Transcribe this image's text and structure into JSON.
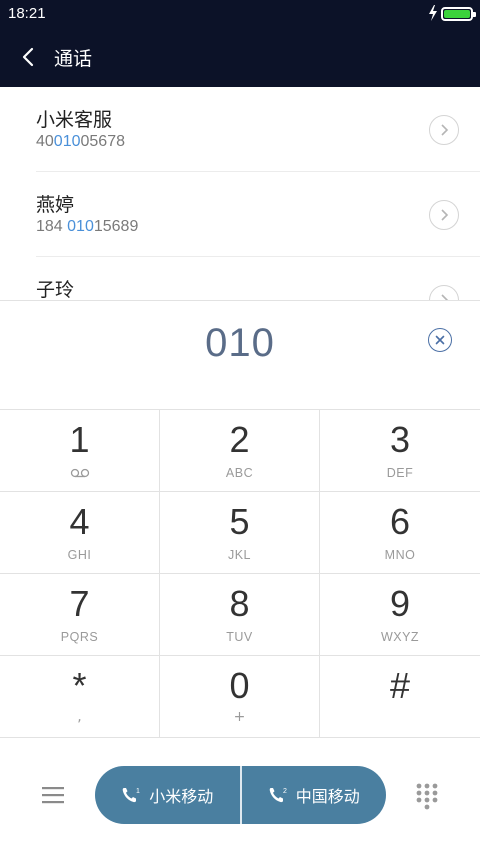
{
  "status": {
    "time": "18:21",
    "battery_level": 1.0,
    "battery_color": "#3bd23b",
    "charging": true
  },
  "header": {
    "title": "通话"
  },
  "results": [
    {
      "name": "小米客服",
      "number_pre": "40",
      "number_match": "010",
      "number_post": "05678"
    },
    {
      "name": "燕婷",
      "number_pre": "184 ",
      "number_match": "010",
      "number_post": "15689"
    },
    {
      "name": "子玲",
      "number_pre": "",
      "number_match": "",
      "number_post": ""
    }
  ],
  "dial_input": {
    "value": "010"
  },
  "keypad": [
    {
      "num": "1",
      "letters": "",
      "icon": "voicemail-icon"
    },
    {
      "num": "2",
      "letters": "ABC"
    },
    {
      "num": "3",
      "letters": "DEF"
    },
    {
      "num": "4",
      "letters": "GHI"
    },
    {
      "num": "5",
      "letters": "JKL"
    },
    {
      "num": "6",
      "letters": "MNO"
    },
    {
      "num": "7",
      "letters": "PQRS"
    },
    {
      "num": "8",
      "letters": "TUV"
    },
    {
      "num": "9",
      "letters": "WXYZ"
    },
    {
      "num": "*",
      "letters": ","
    },
    {
      "num": "0",
      "letters": "+"
    },
    {
      "num": "#",
      "letters": ""
    }
  ],
  "call_buttons": [
    {
      "label": "小米移动",
      "sim": "1"
    },
    {
      "label": "中国移动",
      "sim": "2"
    }
  ],
  "colors": {
    "header_bg": "#0c1228",
    "accent": "#4a7fa0",
    "match_highlight": "#4a90d9",
    "input_text": "#5a6c88"
  }
}
